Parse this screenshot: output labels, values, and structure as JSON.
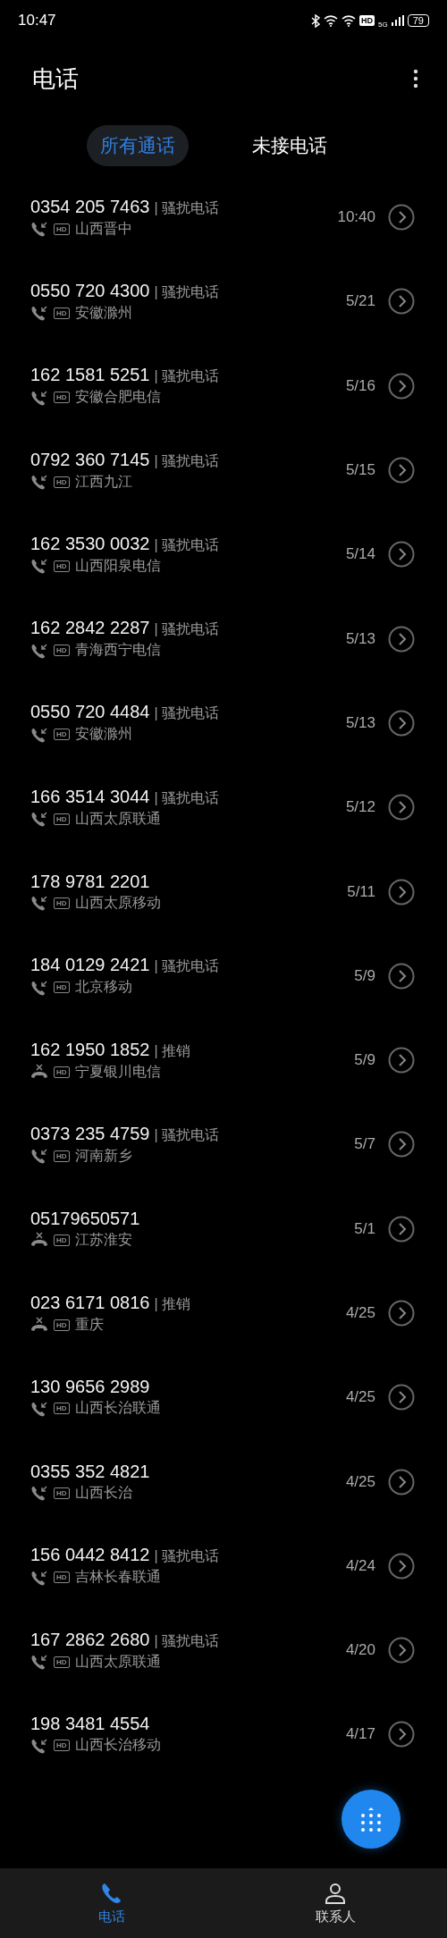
{
  "status_bar": {
    "time": "10:47",
    "hd": "HD",
    "network": "5G",
    "battery": "79"
  },
  "header": {
    "title": "电话"
  },
  "tabs": [
    {
      "label": "所有通话",
      "selected": true
    },
    {
      "label": "未接电话",
      "selected": false
    }
  ],
  "calls": [
    {
      "number": "0354 205 7463",
      "tag": "| 骚扰电话",
      "kind": "incoming",
      "badge": "HD",
      "location": "山西晋中",
      "time": "10:40"
    },
    {
      "number": "0550 720 4300",
      "tag": "| 骚扰电话",
      "kind": "incoming",
      "badge": "HD",
      "location": "安徽滁州",
      "time": "5/21"
    },
    {
      "number": "162 1581 5251",
      "tag": "| 骚扰电话",
      "kind": "incoming",
      "badge": "HD",
      "location": "安徽合肥电信",
      "time": "5/16"
    },
    {
      "number": "0792 360 7145",
      "tag": "| 骚扰电话",
      "kind": "incoming",
      "badge": "HD",
      "location": "江西九江",
      "time": "5/15"
    },
    {
      "number": "162 3530 0032",
      "tag": "| 骚扰电话",
      "kind": "incoming",
      "badge": "HD",
      "location": "山西阳泉电信",
      "time": "5/14"
    },
    {
      "number": "162 2842 2287",
      "tag": "| 骚扰电话",
      "kind": "incoming",
      "badge": "HD",
      "location": "青海西宁电信",
      "time": "5/13"
    },
    {
      "number": "0550 720 4484",
      "tag": "| 骚扰电话",
      "kind": "incoming",
      "badge": "HD",
      "location": "安徽滁州",
      "time": "5/13"
    },
    {
      "number": "166 3514 3044",
      "tag": "| 骚扰电话",
      "kind": "incoming",
      "badge": "HD",
      "location": "山西太原联通",
      "time": "5/12"
    },
    {
      "number": "178 9781 2201",
      "kind": "incoming",
      "badge": "HD",
      "location": "山西太原移动",
      "time": "5/11"
    },
    {
      "number": "184 0129 2421",
      "tag": "| 骚扰电话",
      "kind": "incoming",
      "badge": "HD",
      "location": "北京移动",
      "time": "5/9"
    },
    {
      "number": "162 1950 1852",
      "tag": "| 推销",
      "kind": "rejected",
      "badge": "HD",
      "location": "宁夏银川电信",
      "time": "5/9"
    },
    {
      "number": "0373 235 4759",
      "tag": "| 骚扰电话",
      "kind": "incoming",
      "badge": "HD",
      "location": "河南新乡",
      "time": "5/7"
    },
    {
      "number": "05179650571",
      "kind": "rejected",
      "badge": "HD",
      "location": "江苏淮安",
      "time": "5/1"
    },
    {
      "number": "023 6171 0816",
      "tag": "| 推销",
      "kind": "rejected",
      "badge": "HD",
      "location": "重庆",
      "time": "4/25"
    },
    {
      "number": "130 9656 2989",
      "kind": "incoming",
      "badge": "HD",
      "location": "山西长治联通",
      "time": "4/25"
    },
    {
      "number": "0355 352 4821",
      "kind": "incoming",
      "badge": "HD",
      "location": "山西长治",
      "time": "4/25"
    },
    {
      "number": "156 0442 8412",
      "tag": "| 骚扰电话",
      "kind": "incoming",
      "badge": "HD",
      "location": "吉林长春联通",
      "time": "4/24"
    },
    {
      "number": "167 2862 2680",
      "tag": "| 骚扰电话",
      "kind": "incoming",
      "badge": "HD",
      "location": "山西太原联通",
      "time": "4/20"
    },
    {
      "number": "198 3481 4554",
      "kind": "incoming",
      "badge": "HD",
      "location": "山西长治移动",
      "time": "4/17"
    }
  ],
  "bottom_nav": [
    {
      "label": "电话",
      "kind": "phone",
      "selected": true
    },
    {
      "label": "联系人",
      "kind": "contacts",
      "selected": false
    }
  ]
}
